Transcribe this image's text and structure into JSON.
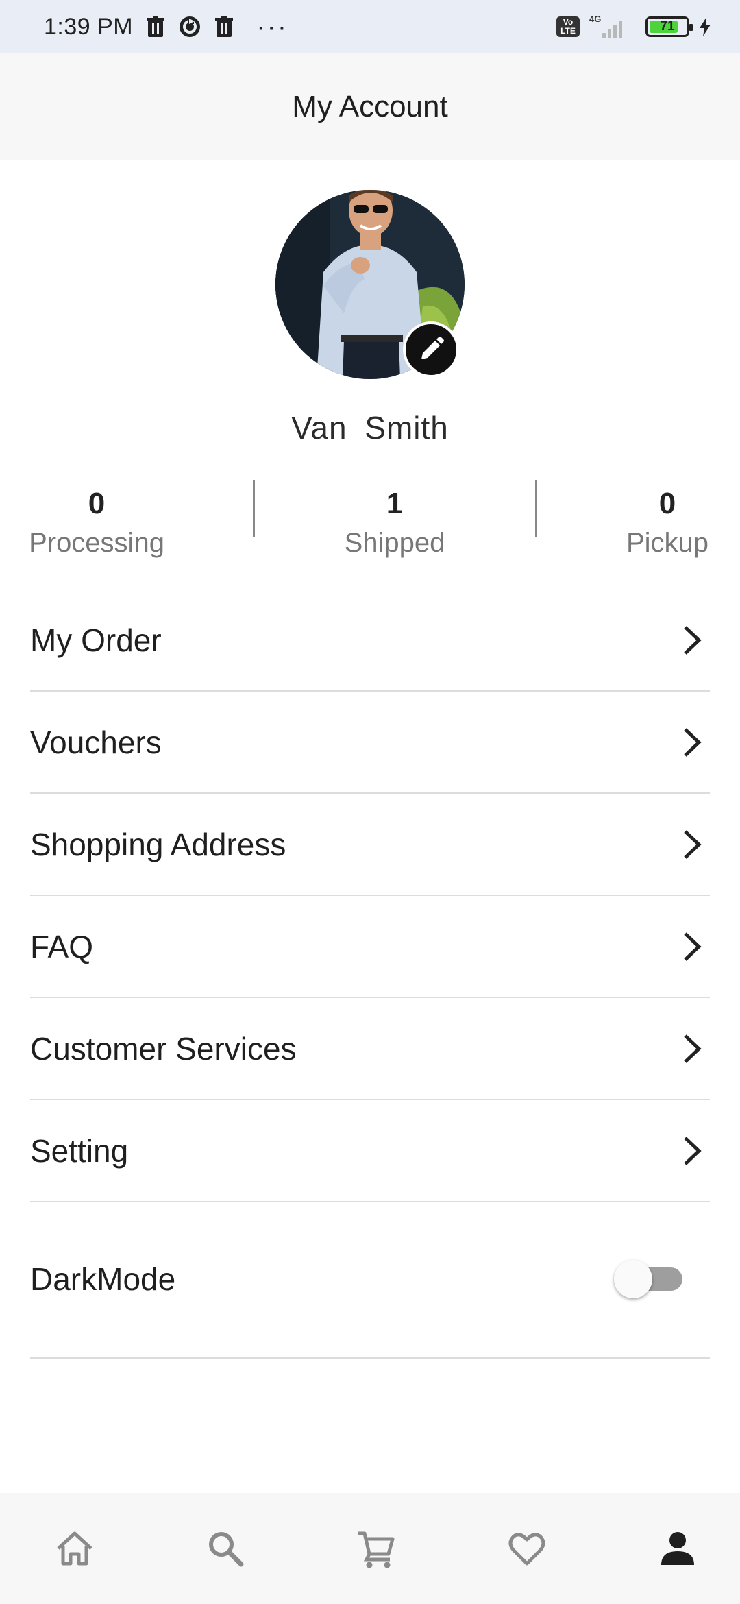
{
  "status_bar": {
    "time": "1:39 PM",
    "dots": "···",
    "volte_top": "Vo",
    "volte_bottom": "LTE",
    "network": "4G",
    "battery": "71",
    "icons": [
      "trash-icon",
      "sync-icon",
      "trash-icon",
      "volte-icon",
      "signal-icon",
      "battery-icon",
      "charging-icon"
    ]
  },
  "header": {
    "title": "My Account"
  },
  "profile": {
    "name": "Van  Smith",
    "edit_icon": "pencil-icon"
  },
  "stats": [
    {
      "value": "0",
      "label": "Processing"
    },
    {
      "value": "1",
      "label": "Shipped"
    },
    {
      "value": "0",
      "label": "Pickup"
    }
  ],
  "menu": [
    {
      "label": "My Order"
    },
    {
      "label": "Vouchers"
    },
    {
      "label": "Shopping Address"
    },
    {
      "label": "FAQ"
    },
    {
      "label": "Customer Services"
    },
    {
      "label": "Setting"
    }
  ],
  "darkmode": {
    "label": "DarkMode",
    "enabled": false
  },
  "bottom_nav": {
    "items": [
      "home-icon",
      "search-icon",
      "cart-icon",
      "heart-icon",
      "person-icon"
    ],
    "active": "person-icon"
  },
  "colors": {
    "status_bar_bg": "#e9eef6",
    "header_bg": "#f7f7f7",
    "battery_fill": "#4cd43a",
    "inactive_icon": "#8a8a8a",
    "active_icon": "#1f1f1f"
  }
}
